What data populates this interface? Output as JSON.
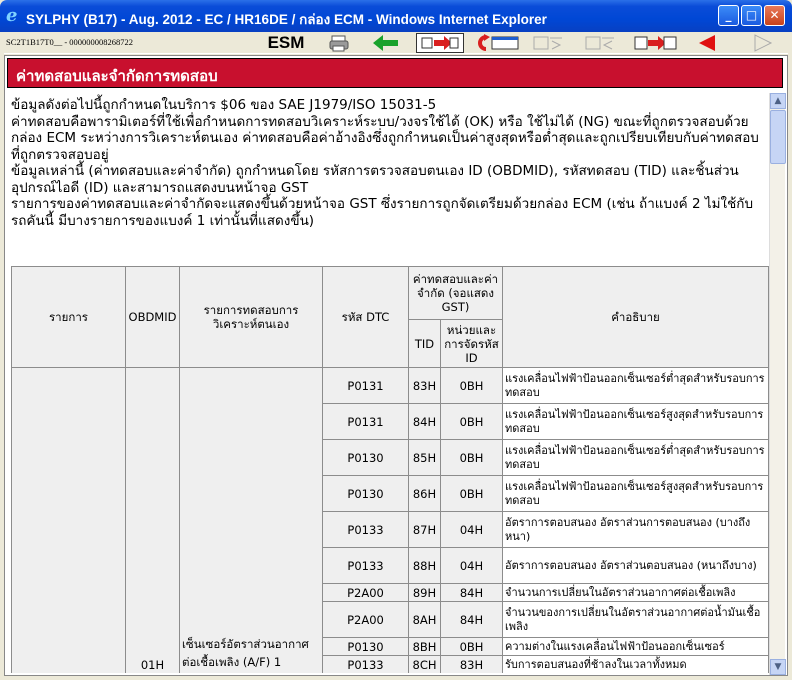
{
  "window": {
    "title": "SYLPHY (B17) - Aug. 2012 - EC / HR16DE / กล่อง ECM - Windows Internet Explorer",
    "min_label": "_",
    "max_label": "□",
    "close_label": "✕"
  },
  "toolbar": {
    "doc_code": "SC2T1B17T0__ - 000000008268722",
    "esm_label": "ESM"
  },
  "page": {
    "heading": "ค่าทดสอบและจำกัดการทดสอบ",
    "paragraphs": [
      "ข้อมูลดังต่อไปนี้ถูกกำหนดในบริการ $06 ของ SAE J1979/ISO 15031-5",
      "ค่าทดสอบคือพารามิเตอร์ที่ใช้เพื่อกำหนดการทดสอบวิเคราะห์ระบบ/วงจรใช้ได้ (OK) หรือ ใช้ไม่ได้ (NG) ขณะที่ถูกตรวจสอบด้วยกล่อง ECM ระหว่างการวิเคราะห์ตนเอง ค่าทดสอบคือค่าอ้างอิงซึ่งถูกกำหนดเป็นค่าสูงสุดหรือต่ำสุดและถูกเปรียบเทียบกับค่าทดสอบที่ถูกตรวจสอบอยู่",
      "ข้อมูลเหล่านี้ (ค่าทดสอบและค่าจำกัด) ถูกกำหนดโดย รหัสการตรวจสอบตนเอง ID (OBDMID), รหัสทดสอบ (TID) และชิ้นส่วนอุปกรณ์ไอดี (ID) และสามารถแสดงบนหน้าจอ GST",
      "รายการของค่าทดสอบและค่าจำกัดจะแสดงขึ้นด้วยหน้าจอ GST ซึ่งรายการถูกจัดเตรียมด้วยกล่อง ECM (เช่น ถ้าแบงค์ 2 ไม่ใช้กับรถคันนี้ มีบางรายการของแบงค์ 1 เท่านั้นที่แสดงขึ้น)"
    ]
  },
  "table": {
    "headers": {
      "item": "รายการ",
      "obdmid": "OBDMID",
      "self_diag": "รายการทดสอบการวิเคราะห์ตนเอง",
      "dtc": "รหัส DTC",
      "test_limit": "ค่าทดสอบและค่าจำกัด (จอแสดง GST)",
      "tid": "TID",
      "unit_id": "หน่วยและการจัดรหัส ID",
      "description": "คำอธิบาย"
    },
    "obdmid_value": "01H",
    "self_diag_value": "เซ็นเซอร์อัตราส่วนอากาศต่อเชื้อเพลิง (A/F) 1",
    "rows": [
      {
        "dtc": "P0131",
        "tid": "83H",
        "unit": "0BH",
        "desc": "แรงเคลื่อนไฟฟ้าป้อนออกเซ็นเซอร์ต่ำสุดสำหรับรอบการทดสอบ"
      },
      {
        "dtc": "P0131",
        "tid": "84H",
        "unit": "0BH",
        "desc": "แรงเคลื่อนไฟฟ้าป้อนออกเซ็นเซอร์สูงสุดสำหรับรอบการทดสอบ"
      },
      {
        "dtc": "P0130",
        "tid": "85H",
        "unit": "0BH",
        "desc": "แรงเคลื่อนไฟฟ้าป้อนออกเซ็นเซอร์ต่ำสุดสำหรับรอบการทดสอบ"
      },
      {
        "dtc": "P0130",
        "tid": "86H",
        "unit": "0BH",
        "desc": "แรงเคลื่อนไฟฟ้าป้อนออกเซ็นเซอร์สูงสุดสำหรับรอบการทดสอบ"
      },
      {
        "dtc": "P0133",
        "tid": "87H",
        "unit": "04H",
        "desc": "อัตราการตอบสนอง อัตราส่วนการตอบสนอง (บางถึงหนา)"
      },
      {
        "dtc": "P0133",
        "tid": "88H",
        "unit": "04H",
        "desc": "อัตราการตอบสนอง อัตราส่วนตอบสนอง (หนาถึงบาง)"
      },
      {
        "dtc": "P2A00",
        "tid": "89H",
        "unit": "84H",
        "desc": "จำนวนการเปลี่ยนในอัตราส่วนอากาศต่อเชื้อเพลิง"
      },
      {
        "dtc": "P2A00",
        "tid": "8AH",
        "unit": "84H",
        "desc": "จำนวนของการเปลี่ยนในอัตราส่วนอากาศต่อน้ำมันเชื้อเพลิง"
      },
      {
        "dtc": "P0130",
        "tid": "8BH",
        "unit": "0BH",
        "desc": "ความต่างในแรงเคลื่อนไฟฟ้าป้อนออกเซ็นเซอร์"
      },
      {
        "dtc": "P0133",
        "tid": "8CH",
        "unit": "83H",
        "desc": "รับการตอบสนองที่ช้าลงในเวลาทั้งหมด"
      }
    ]
  }
}
